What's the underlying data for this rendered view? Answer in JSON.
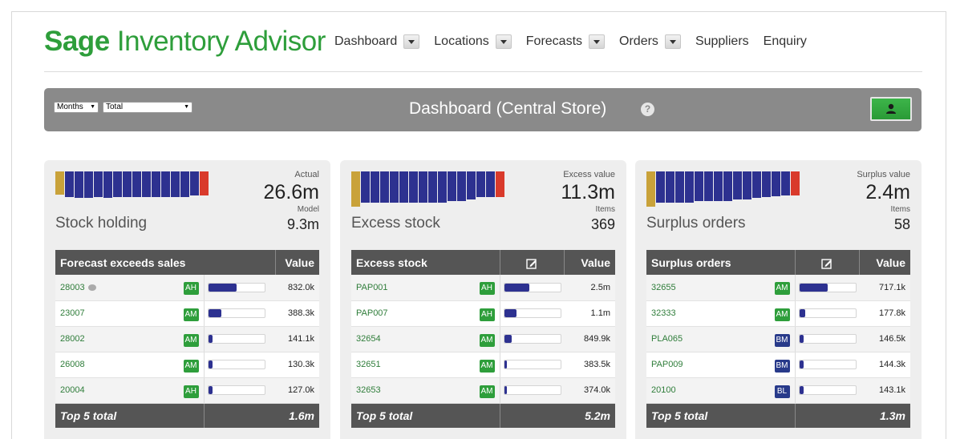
{
  "brand": {
    "bold": "Sage",
    "rest": " Inventory Advisor",
    "color": "#2e9e3b"
  },
  "nav": [
    {
      "label": "Dashboard",
      "dropdown": true
    },
    {
      "label": "Locations",
      "dropdown": true
    },
    {
      "label": "Forecasts",
      "dropdown": true
    },
    {
      "label": "Orders",
      "dropdown": true
    },
    {
      "label": "Suppliers",
      "dropdown": false
    },
    {
      "label": "Enquiry",
      "dropdown": false
    }
  ],
  "dashbar": {
    "period": "Months",
    "scope": "Total",
    "title": "Dashboard (Central Store)",
    "help_icon": "question-icon",
    "user_icon": "user-icon"
  },
  "panels": [
    {
      "name": "Stock holding",
      "big_label": "Actual",
      "big_value": "26.6m",
      "sub_label": "Model",
      "sub_value": "9.3m",
      "spark": [
        {
          "h": 0.62,
          "c": "#c9a23a"
        },
        {
          "h": 0.7,
          "c": "#2d3190"
        },
        {
          "h": 0.72,
          "c": "#2d3190"
        },
        {
          "h": 0.72,
          "c": "#2d3190"
        },
        {
          "h": 0.7,
          "c": "#2d3190"
        },
        {
          "h": 0.72,
          "c": "#2d3190"
        },
        {
          "h": 0.7,
          "c": "#2d3190"
        },
        {
          "h": 0.7,
          "c": "#2d3190"
        },
        {
          "h": 0.7,
          "c": "#2d3190"
        },
        {
          "h": 0.7,
          "c": "#2d3190"
        },
        {
          "h": 0.7,
          "c": "#2d3190"
        },
        {
          "h": 0.7,
          "c": "#2d3190"
        },
        {
          "h": 0.7,
          "c": "#2d3190"
        },
        {
          "h": 0.7,
          "c": "#2d3190"
        },
        {
          "h": 0.66,
          "c": "#2d3190"
        },
        {
          "h": 0.66,
          "c": "#d93a2b"
        }
      ],
      "table": {
        "headers": [
          "Forecast exceeds sales",
          "Value"
        ],
        "has_edit": false,
        "rows": [
          {
            "code": "28003",
            "comment": true,
            "badge": "AH",
            "badge_color": "green",
            "fill": 0.5,
            "value": "832.0k"
          },
          {
            "code": "23007",
            "comment": false,
            "badge": "AM",
            "badge_color": "green",
            "fill": 0.23,
            "value": "388.3k"
          },
          {
            "code": "28002",
            "comment": false,
            "badge": "AM",
            "badge_color": "green",
            "fill": 0.08,
            "value": "141.1k"
          },
          {
            "code": "26008",
            "comment": false,
            "badge": "AM",
            "badge_color": "green",
            "fill": 0.08,
            "value": "130.3k"
          },
          {
            "code": "20004",
            "comment": false,
            "badge": "AH",
            "badge_color": "green",
            "fill": 0.08,
            "value": "127.0k"
          }
        ],
        "footer_label": "Top 5 total",
        "footer_value": "1.6m"
      }
    },
    {
      "name": "Excess stock",
      "big_label": "Excess value",
      "big_value": "11.3m",
      "sub_label": "Items",
      "sub_value": "369",
      "spark": [
        {
          "h": 0.95,
          "c": "#c9a23a"
        },
        {
          "h": 0.85,
          "c": "#2d3190"
        },
        {
          "h": 0.85,
          "c": "#2d3190"
        },
        {
          "h": 0.85,
          "c": "#2d3190"
        },
        {
          "h": 0.85,
          "c": "#2d3190"
        },
        {
          "h": 0.85,
          "c": "#2d3190"
        },
        {
          "h": 0.85,
          "c": "#2d3190"
        },
        {
          "h": 0.85,
          "c": "#2d3190"
        },
        {
          "h": 0.85,
          "c": "#2d3190"
        },
        {
          "h": 0.85,
          "c": "#2d3190"
        },
        {
          "h": 0.8,
          "c": "#2d3190"
        },
        {
          "h": 0.8,
          "c": "#2d3190"
        },
        {
          "h": 0.75,
          "c": "#2d3190"
        },
        {
          "h": 0.7,
          "c": "#2d3190"
        },
        {
          "h": 0.7,
          "c": "#2d3190"
        },
        {
          "h": 0.7,
          "c": "#d93a2b"
        }
      ],
      "table": {
        "headers": [
          "Excess stock",
          "Value"
        ],
        "has_edit": true,
        "rows": [
          {
            "code": "PAP001",
            "comment": false,
            "badge": "AH",
            "badge_color": "green",
            "fill": 0.45,
            "value": "2.5m"
          },
          {
            "code": "PAP007",
            "comment": false,
            "badge": "AH",
            "badge_color": "green",
            "fill": 0.22,
            "value": "1.1m"
          },
          {
            "code": "32654",
            "comment": false,
            "badge": "AM",
            "badge_color": "green",
            "fill": 0.14,
            "value": "849.9k"
          },
          {
            "code": "32651",
            "comment": false,
            "badge": "AM",
            "badge_color": "green",
            "fill": 0.05,
            "value": "383.5k"
          },
          {
            "code": "32653",
            "comment": false,
            "badge": "AM",
            "badge_color": "green",
            "fill": 0.05,
            "value": "374.0k"
          }
        ],
        "footer_label": "Top 5 total",
        "footer_value": "5.2m"
      }
    },
    {
      "name": "Surplus orders",
      "big_label": "Surplus value",
      "big_value": "2.4m",
      "sub_label": "Items",
      "sub_value": "58",
      "spark": [
        {
          "h": 0.95,
          "c": "#c9a23a"
        },
        {
          "h": 0.85,
          "c": "#2d3190"
        },
        {
          "h": 0.85,
          "c": "#2d3190"
        },
        {
          "h": 0.85,
          "c": "#2d3190"
        },
        {
          "h": 0.85,
          "c": "#2d3190"
        },
        {
          "h": 0.8,
          "c": "#2d3190"
        },
        {
          "h": 0.8,
          "c": "#2d3190"
        },
        {
          "h": 0.8,
          "c": "#2d3190"
        },
        {
          "h": 0.8,
          "c": "#2d3190"
        },
        {
          "h": 0.75,
          "c": "#2d3190"
        },
        {
          "h": 0.75,
          "c": "#2d3190"
        },
        {
          "h": 0.72,
          "c": "#2d3190"
        },
        {
          "h": 0.7,
          "c": "#2d3190"
        },
        {
          "h": 0.68,
          "c": "#2d3190"
        },
        {
          "h": 0.65,
          "c": "#2d3190"
        },
        {
          "h": 0.65,
          "c": "#d93a2b"
        }
      ],
      "table": {
        "headers": [
          "Surplus orders",
          "Value"
        ],
        "has_edit": true,
        "rows": [
          {
            "code": "32655",
            "comment": false,
            "badge": "AM",
            "badge_color": "green",
            "fill": 0.5,
            "value": "717.1k"
          },
          {
            "code": "32333",
            "comment": false,
            "badge": "AM",
            "badge_color": "green",
            "fill": 0.1,
            "value": "177.8k"
          },
          {
            "code": "PLA065",
            "comment": false,
            "badge": "BM",
            "badge_color": "blue",
            "fill": 0.08,
            "value": "146.5k"
          },
          {
            "code": "PAP009",
            "comment": false,
            "badge": "BM",
            "badge_color": "blue",
            "fill": 0.08,
            "value": "144.3k"
          },
          {
            "code": "20100",
            "comment": false,
            "badge": "BL",
            "badge_color": "blue",
            "fill": 0.08,
            "value": "143.1k"
          }
        ],
        "footer_label": "Top 5 total",
        "footer_value": "1.3m"
      }
    }
  ]
}
